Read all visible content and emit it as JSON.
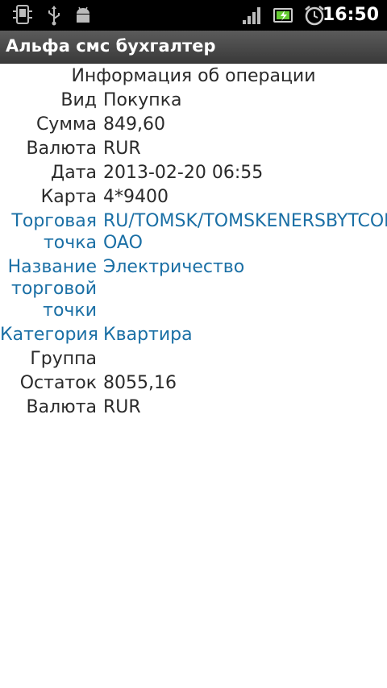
{
  "status_bar": {
    "time": "16:50",
    "icons": [
      "phone-sync-icon",
      "usb-icon",
      "android-icon",
      "signal-icon",
      "battery-charging-icon",
      "alarm-clock-icon"
    ]
  },
  "app": {
    "title": "Альфа смс бухгалтер"
  },
  "details": {
    "heading": "Информация об операции",
    "rows": [
      {
        "label": "Вид",
        "value": "Покупка"
      },
      {
        "label": "Сумма",
        "value": "849,60"
      },
      {
        "label": "Валюта",
        "value": "RUR"
      },
      {
        "label": "Дата",
        "value": "2013-02-20 06:55"
      },
      {
        "label": "Карта",
        "value": "4*9400"
      },
      {
        "label": "Торговая точка",
        "value": "RU/TOMSK/TOMSKENERSBYTCOM OAO"
      },
      {
        "label": "Название торговой точки",
        "value": "Электричество"
      },
      {
        "label": "Категория",
        "value": "Квартира"
      },
      {
        "label": "Группа",
        "value": ""
      },
      {
        "label": "Остаток",
        "value": "8055,16"
      },
      {
        "label": "Валюта",
        "value": "RUR"
      }
    ]
  },
  "colors": {
    "link": "#1a6fa5",
    "text": "#2a2a2a",
    "title_bar": "#4a4a4a"
  }
}
